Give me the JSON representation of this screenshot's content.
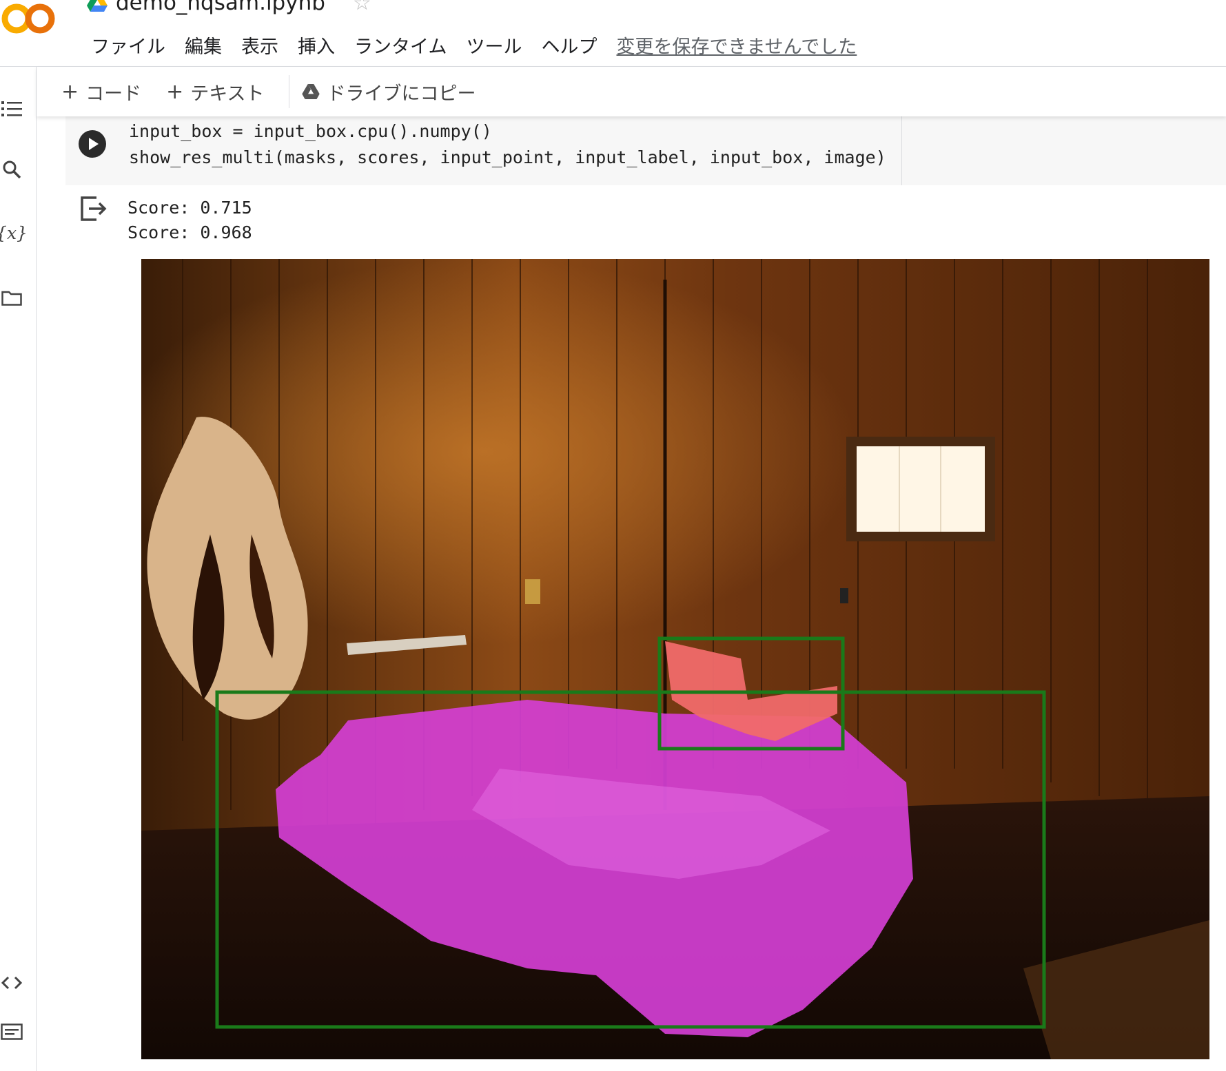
{
  "header": {
    "app_logo": "CO",
    "notebook_title": "demo_hqsam.ipynb",
    "menu": [
      "ファイル",
      "編集",
      "表示",
      "挿入",
      "ランタイム",
      "ツール",
      "ヘルプ"
    ],
    "save_notice": "変更を保存できませんでした"
  },
  "toolbar": {
    "add_code": "コード",
    "add_text": "テキスト",
    "copy_to_drive": "ドライブにコピー"
  },
  "cell": {
    "code_line1": "input_box = input_box.cpu().numpy()",
    "code_line2": "show_res_multi(masks, scores, input_point, input_label, input_box, image)"
  },
  "output": {
    "score_lines": [
      "Score: 0.715",
      "Score: 0.968"
    ]
  },
  "icons": {
    "rail": [
      "toc-icon",
      "search-icon",
      "variables-icon",
      "files-icon",
      "code-snippets-icon",
      "terminal-icon"
    ],
    "header": [
      "colab-logo",
      "drive-icon",
      "star-icon"
    ]
  },
  "colors": {
    "box_outline": "#1a7a1a",
    "bed_mask": "#d43fd4",
    "pillow_mask": "#f06a6a"
  }
}
